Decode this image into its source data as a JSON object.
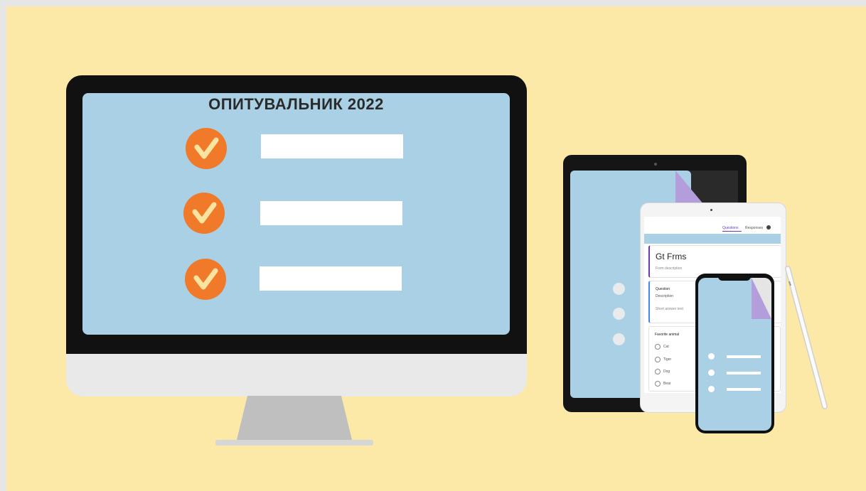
{
  "monitor": {
    "title": "ОПИТУВАЛЬНИК  2022",
    "items": [
      {
        "icon": "checkmark-circle-icon"
      },
      {
        "icon": "checkmark-circle-icon"
      },
      {
        "icon": "checkmark-circle-icon"
      }
    ]
  },
  "ipad": {
    "tabs": [
      "Questions",
      "Responses"
    ],
    "form_title": "Gt Frms",
    "form_description": "Form description",
    "question": {
      "title": "Question",
      "description": "Description",
      "answer_placeholder": "Short answer text"
    },
    "choice_question": {
      "title": "Favorite animal",
      "options": [
        "Cat",
        "Tiger",
        "Dog",
        "Bear"
      ]
    }
  },
  "colors": {
    "background": "#fce9a8",
    "screen": "#a9d0e4",
    "check_orange": "#f07a2a",
    "check_mark": "#fbe3a0",
    "accent_purple": "#b39ddb",
    "forms_purple": "#673ab7"
  }
}
